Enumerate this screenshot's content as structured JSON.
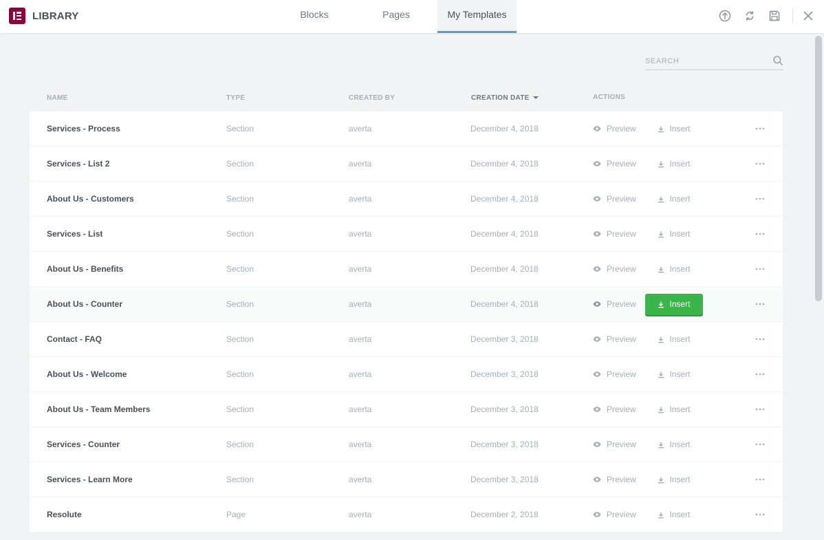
{
  "header": {
    "title": "LIBRARY",
    "tabs": [
      {
        "label": "Blocks",
        "active": false
      },
      {
        "label": "Pages",
        "active": false
      },
      {
        "label": "My Templates",
        "active": true
      }
    ],
    "icons": [
      "upload-icon",
      "sync-icon",
      "save-icon",
      "close-icon"
    ]
  },
  "search": {
    "placeholder": "SEARCH",
    "value": ""
  },
  "table": {
    "columns": [
      "NAME",
      "TYPE",
      "CREATED BY",
      "CREATION DATE",
      "ACTIONS"
    ],
    "sort_column": "CREATION DATE",
    "rows": [
      {
        "name": "Services - Process",
        "type": "Section",
        "author": "averta",
        "date": "December 4, 2018",
        "preview": "Preview",
        "insert": "Insert"
      },
      {
        "name": "Services - List 2",
        "type": "Section",
        "author": "averta",
        "date": "December 4, 2018",
        "preview": "Preview",
        "insert": "Insert"
      },
      {
        "name": "About Us - Customers",
        "type": "Section",
        "author": "averta",
        "date": "December 4, 2018",
        "preview": "Preview",
        "insert": "Insert"
      },
      {
        "name": "Services - List",
        "type": "Section",
        "author": "averta",
        "date": "December 4, 2018",
        "preview": "Preview",
        "insert": "Insert"
      },
      {
        "name": "About Us - Benefits",
        "type": "Section",
        "author": "averta",
        "date": "December 4, 2018",
        "preview": "Preview",
        "insert": "Insert"
      },
      {
        "name": "About Us - Counter",
        "type": "Section",
        "author": "averta",
        "date": "December 4, 2018",
        "preview": "Preview",
        "insert": "Insert"
      },
      {
        "name": "Contact - FAQ",
        "type": "Section",
        "author": "averta",
        "date": "December 3, 2018",
        "preview": "Preview",
        "insert": "Insert"
      },
      {
        "name": "About Us - Welcome",
        "type": "Section",
        "author": "averta",
        "date": "December 3, 2018",
        "preview": "Preview",
        "insert": "Insert"
      },
      {
        "name": "About Us - Team Members",
        "type": "Section",
        "author": "averta",
        "date": "December 3, 2018",
        "preview": "Preview",
        "insert": "Insert"
      },
      {
        "name": "Services - Counter",
        "type": "Section",
        "author": "averta",
        "date": "December 3, 2018",
        "preview": "Preview",
        "insert": "Insert"
      },
      {
        "name": "Services - Learn More",
        "type": "Section",
        "author": "averta",
        "date": "December 3, 2018",
        "preview": "Preview",
        "insert": "Insert"
      },
      {
        "name": "Resolute",
        "type": "Page",
        "author": "averta",
        "date": "December 2, 2018",
        "preview": "Preview",
        "insert": "Insert"
      }
    ],
    "hovered_row": 5
  },
  "colors": {
    "brand": "#92003b",
    "accent": "#4f9fd1",
    "insert_button": "#39b54a"
  }
}
